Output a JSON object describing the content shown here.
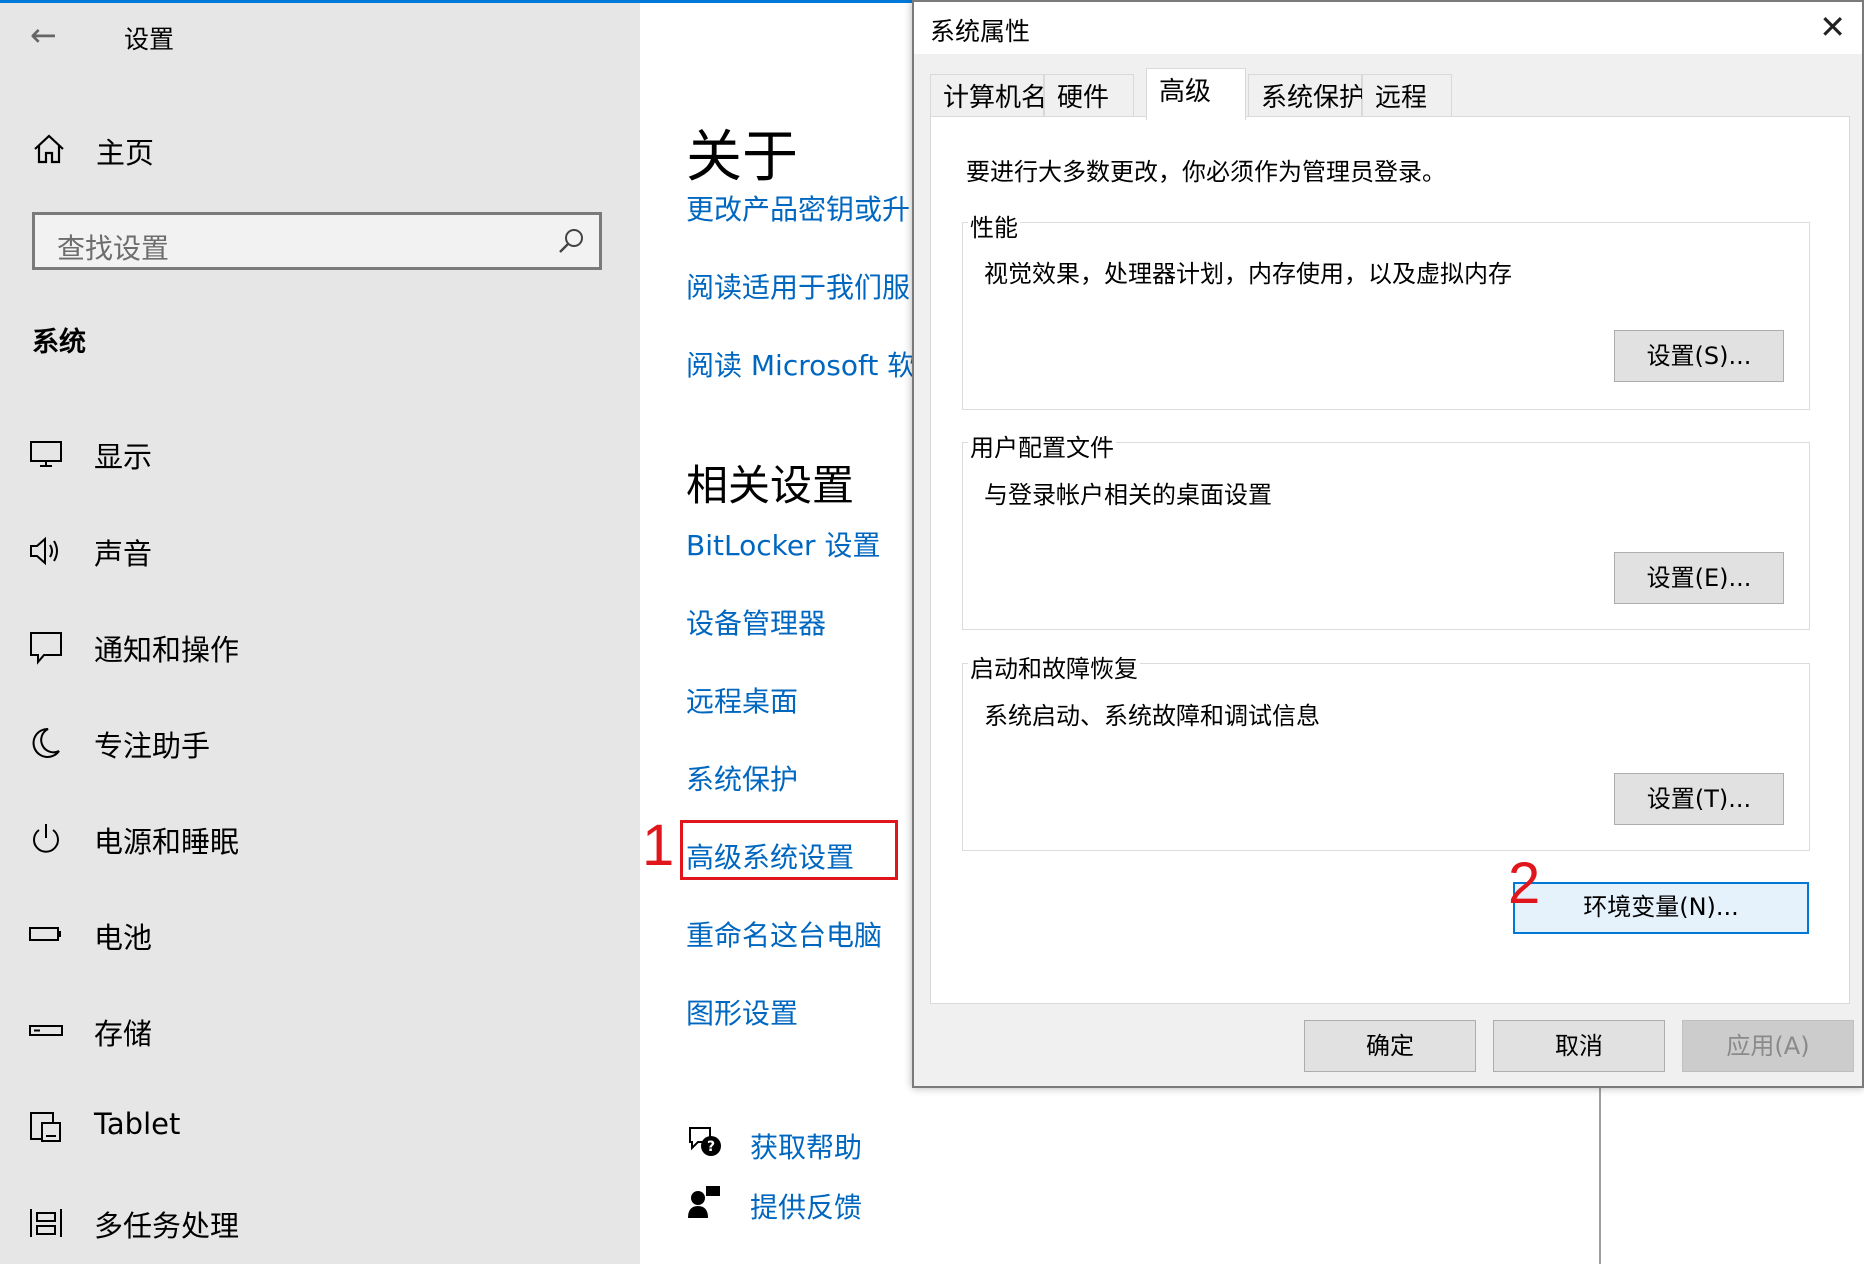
{
  "settings": {
    "title": "设置",
    "back_glyph": "←",
    "home_label": "主页",
    "search_placeholder": "查找设置",
    "section_title": "系统",
    "nav_items": [
      {
        "label": "显示",
        "icon": "display-icon"
      },
      {
        "label": "声音",
        "icon": "speaker-icon"
      },
      {
        "label": "通知和操作",
        "icon": "notification-icon"
      },
      {
        "label": "专注助手",
        "icon": "moon-icon"
      },
      {
        "label": "电源和睡眠",
        "icon": "power-icon"
      },
      {
        "label": "电池",
        "icon": "battery-icon"
      },
      {
        "label": "存储",
        "icon": "storage-icon"
      },
      {
        "label": "Tablet",
        "icon": "tablet-icon"
      },
      {
        "label": "多任务处理",
        "icon": "multitask-icon"
      }
    ]
  },
  "about": {
    "heading": "关于",
    "links": [
      "更改产品密钥或升",
      "阅读适用于我们服",
      "阅读 Microsoft 软件"
    ]
  },
  "related": {
    "heading": "相关设置",
    "links": [
      "BitLocker 设置",
      "设备管理器",
      "远程桌面",
      "系统保护",
      "高级系统设置",
      "重命名这台电脑",
      "图形设置"
    ]
  },
  "help": {
    "get_help": "获取帮助",
    "feedback": "提供反馈"
  },
  "annotations": {
    "one": "1",
    "two": "2"
  },
  "dialog": {
    "title": "系统属性",
    "close_glyph": "✕",
    "tabs": [
      "计算机名",
      "硬件",
      "高级",
      "系统保护",
      "远程"
    ],
    "admin_note": "要进行大多数更改，你必须作为管理员登录。",
    "performance": {
      "label": "性能",
      "desc": "视觉效果，处理器计划，内存使用，以及虚拟内存",
      "button": "设置(S)..."
    },
    "profiles": {
      "label": "用户配置文件",
      "desc": "与登录帐户相关的桌面设置",
      "button": "设置(E)..."
    },
    "startup": {
      "label": "启动和故障恢复",
      "desc": "系统启动、系统故障和调试信息",
      "button": "设置(T)..."
    },
    "env_button": "环境变量(N)...",
    "ok": "确定",
    "cancel": "取消",
    "apply": "应用(A)"
  },
  "colors": {
    "accent": "#0078d7",
    "link": "#0067c0",
    "annotation": "#e0161c"
  }
}
